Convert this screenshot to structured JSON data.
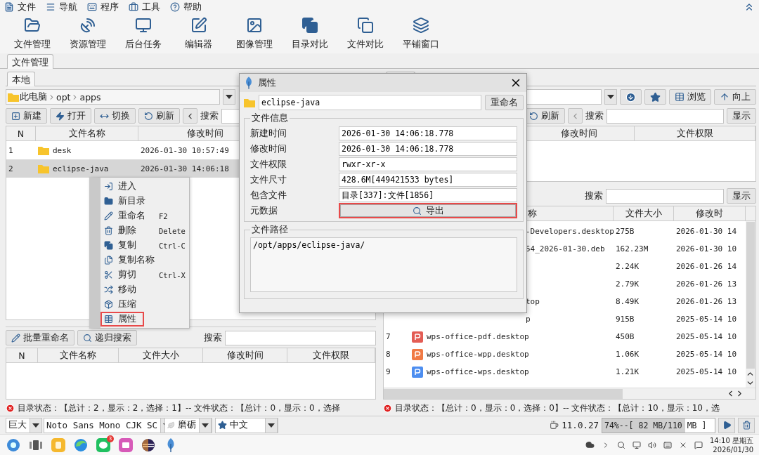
{
  "menu": [
    "文件",
    "导航",
    "程序",
    "工具",
    "帮助"
  ],
  "toolbar": [
    "文件管理",
    "资源管理",
    "后台任务",
    "编辑器",
    "图像管理",
    "目录对比",
    "文件对比",
    "平铺窗口"
  ],
  "main_tab": "文件管理",
  "left_panel": {
    "tab": "本地",
    "path": [
      "此电脑",
      "opt",
      "apps"
    ],
    "buttons": [
      "新建",
      "打开",
      "切换",
      "刷新"
    ],
    "search_label": "搜索",
    "columns": [
      "N",
      "文件名称",
      "修改时间"
    ],
    "rows": [
      {
        "n": "1",
        "name": "desk",
        "time": "2026-01-30 10:57:49",
        "selected": false
      },
      {
        "n": "2",
        "name": "eclipse-java",
        "time": "2026-01-30 14:06:18",
        "selected": true
      }
    ],
    "lower": {
      "buttons": [
        "批量重命名",
        "递归搜索"
      ],
      "search_label": "搜索",
      "columns": [
        "N",
        "文件名称",
        "文件大小",
        "修改时间",
        "文件权限"
      ]
    },
    "status": "目录状态：【总计：2，显示：2，选择：1】-- 文件状态：【总计：0，显示：0，选择"
  },
  "context_menu": [
    {
      "label": "进入",
      "highlighted": false
    },
    {
      "label": "新目录",
      "highlighted": false
    },
    {
      "label": "重命名",
      "shortcut": "F2",
      "highlighted": false
    },
    {
      "label": "删除",
      "shortcut": "Delete",
      "highlighted": false
    },
    {
      "label": "复制",
      "shortcut": "Ctrl-C",
      "highlighted": false
    },
    {
      "label": "复制名称",
      "highlighted": false
    },
    {
      "label": "剪切",
      "shortcut": "Ctrl-X",
      "highlighted": false
    },
    {
      "label": "移动",
      "highlighted": false
    },
    {
      "label": "压缩",
      "highlighted": false
    },
    {
      "label": "属性",
      "highlighted": true
    }
  ],
  "right_panel": {
    "buttons": [
      "浏览",
      "向上"
    ],
    "refresh": "刷新",
    "search_label": "搜索",
    "show": "显示",
    "columns": [
      "修改时间",
      "文件权限"
    ],
    "lower": {
      "search_label": "搜索",
      "show": "显示",
      "columns": [
        "称",
        "文件大小",
        "修改时"
      ],
      "rows": [
        {
          "name": "-Developers.desktop",
          "size": "275B",
          "time": "2026-01-30 14"
        },
        {
          "name": "54_2026-01-30.deb",
          "size": "162.23M",
          "time": "2026-01-30 10"
        },
        {
          "size": "2.24K",
          "time": "2026-01-26 14"
        },
        {
          "size": "2.79K",
          "time": "2026-01-26 13"
        },
        {
          "name": "top",
          "size": "8.49K",
          "time": "2026-01-26 13"
        },
        {
          "name": "p",
          "size": "915B",
          "time": "2025-05-14 10"
        },
        {
          "n": "7",
          "name": "wps-office-pdf.desktop",
          "size": "450B",
          "time": "2025-05-14 10",
          "color": "#e35d55"
        },
        {
          "n": "8",
          "name": "wps-office-wpp.desktop",
          "size": "1.06K",
          "time": "2025-05-14 10",
          "color": "#f07a45"
        },
        {
          "n": "9",
          "name": "wps-office-wps.desktop",
          "size": "1.21K",
          "time": "2025-05-14 10",
          "color": "#4d8ef0"
        }
      ]
    },
    "status": "目录状态：【总计：0，显示：0，选择：0】-- 文件状态：【总计：10，显示：10，选"
  },
  "dialog": {
    "title": "属性",
    "name": "eclipse-java",
    "rename": "重命名",
    "info_title": "文件信息",
    "fields": [
      {
        "kind": "text",
        "label": "新建时间",
        "value": "2026-01-30 14:06:18.778"
      },
      {
        "kind": "text",
        "label": "修改时间",
        "value": "2026-01-30 14:06:18.778"
      },
      {
        "kind": "text",
        "label": "文件权限",
        "value": "rwxr-xr-x"
      },
      {
        "kind": "text",
        "label": "文件尺寸",
        "value": "428.6M[449421533 bytes]"
      },
      {
        "kind": "text",
        "label": "包含文件",
        "value": "目录[337]:文件[1856]"
      },
      {
        "kind": "button",
        "label": "元数据",
        "value": "导出",
        "highlighted": true
      }
    ],
    "path_title": "文件路径",
    "path": "/opt/apps/eclipse-java/"
  },
  "footer": {
    "size": "巨大",
    "font": "Noto Sans Mono CJK SC",
    "theme": "磨砺",
    "language": "中文",
    "java": "11.0.27",
    "memory": {
      "text": "74%--[ 82 MB/110 MB ]",
      "level": 0.74
    }
  },
  "taskbar": {
    "badge": "3",
    "time": "14:10 星期五",
    "date": "2026/01/30"
  }
}
